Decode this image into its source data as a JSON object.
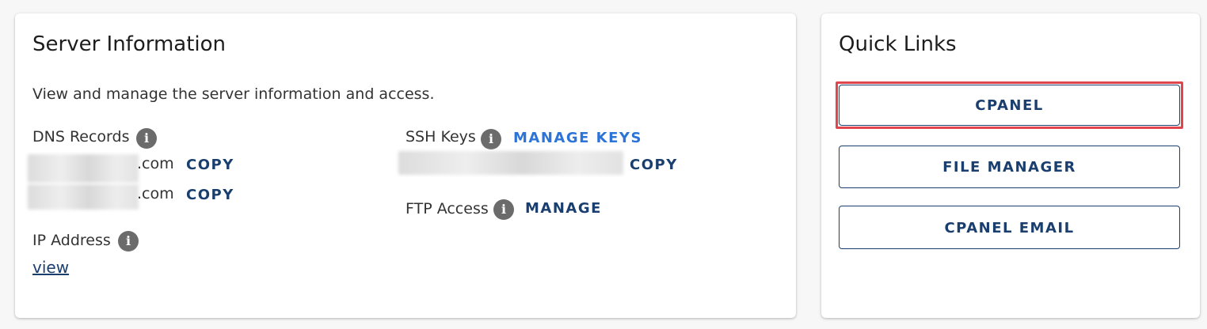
{
  "server_info": {
    "title": "Server Information",
    "description": "View and manage the server information and access.",
    "dns_records": {
      "label": "DNS Records",
      "entries": [
        {
          "suffix": ".com",
          "copy_label": "COPY"
        },
        {
          "suffix": ".com",
          "copy_label": "COPY"
        }
      ]
    },
    "ip_address": {
      "label": "IP Address",
      "view_label": "view"
    },
    "ssh_keys": {
      "label": "SSH Keys",
      "manage_label": "MANAGE KEYS",
      "copy_label": "COPY"
    },
    "ftp_access": {
      "label": "FTP Access",
      "manage_label": "MANAGE"
    }
  },
  "quick_links": {
    "title": "Quick Links",
    "buttons": [
      {
        "label": "CPANEL"
      },
      {
        "label": "FILE MANAGER"
      },
      {
        "label": "CPANEL EMAIL"
      }
    ]
  },
  "colors": {
    "primary_navy": "#1a3f6e",
    "link_blue": "#2c74d8",
    "highlight_red": "#e0444c",
    "info_icon_gray": "#6b6b6b"
  },
  "icons": {
    "info": "info-icon"
  }
}
